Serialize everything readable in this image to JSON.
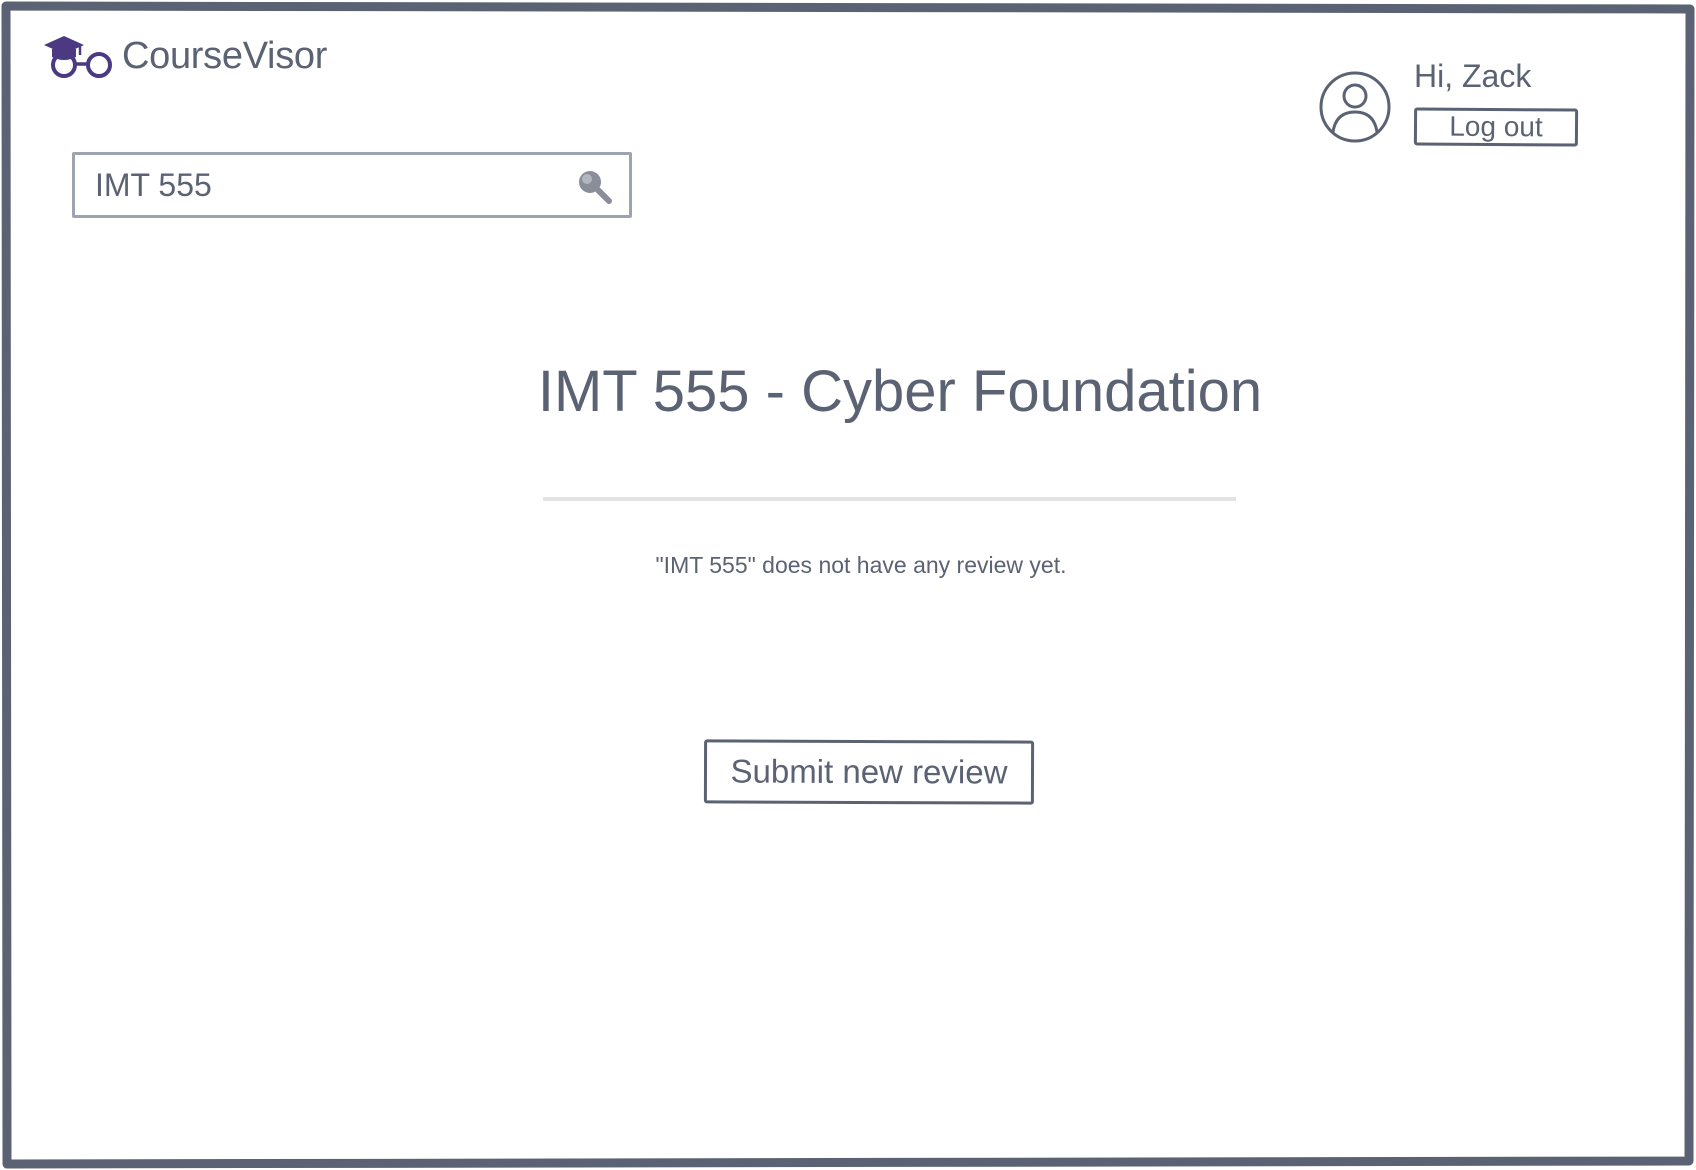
{
  "app": {
    "name": "CourseVisor",
    "logo_icon": "graduation-cap-glasses-icon",
    "accent_color": "#4b3a82",
    "text_color": "#5b6273"
  },
  "header": {
    "greeting": "Hi, Zack",
    "logout_label": "Log out",
    "avatar_icon": "user-avatar-icon"
  },
  "search": {
    "value": "IMT 555",
    "icon": "search-icon"
  },
  "course": {
    "title": "IMT 555 - Cyber Foundation",
    "empty_message": "\"IMT 555\" does not have any review yet.",
    "submit_label": "Submit new review"
  }
}
